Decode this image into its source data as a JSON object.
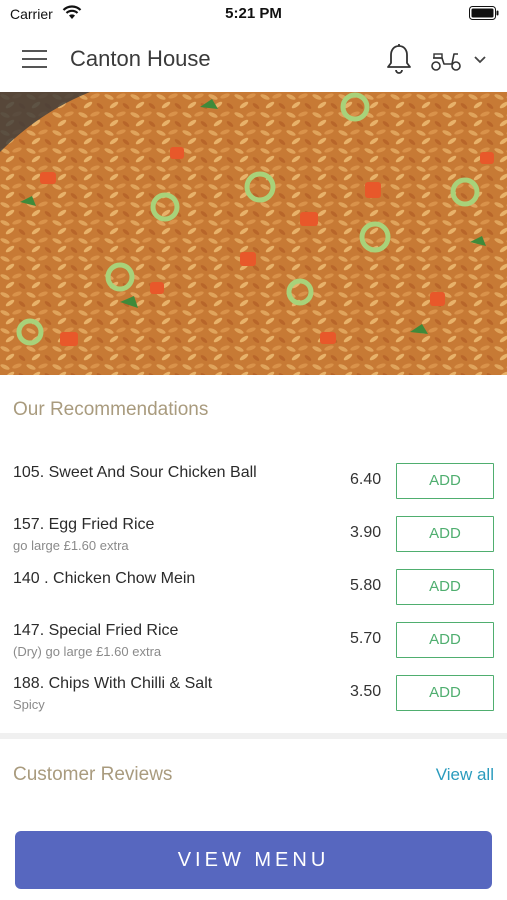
{
  "status_bar": {
    "carrier": "Carrier",
    "time": "5:21 PM"
  },
  "header": {
    "title": "Canton House",
    "icons": [
      "menu-icon",
      "bell-icon",
      "scooter-icon",
      "chevron-down-icon"
    ]
  },
  "recommendations": {
    "title": "Our Recommendations",
    "items": [
      {
        "name": "105. Sweet And Sour Chicken Ball",
        "desc": "",
        "price": "6.40",
        "button": "ADD"
      },
      {
        "name": "157. Egg Fried Rice",
        "desc": "go large £1.60 extra",
        "price": "3.90",
        "button": "ADD"
      },
      {
        "name": "140 . Chicken Chow Mein",
        "desc": "",
        "price": "5.80",
        "button": "ADD"
      },
      {
        "name": "147. Special Fried Rice",
        "desc": "(Dry) go large £1.60 extra",
        "price": "5.70",
        "button": "ADD"
      },
      {
        "name": "188. Chips With Chilli & Salt",
        "desc": "Spicy",
        "price": "3.50",
        "button": "ADD"
      }
    ]
  },
  "reviews": {
    "title": "Customer Reviews",
    "view_all": "View all"
  },
  "footer": {
    "view_menu": "VIEW MENU"
  },
  "colors": {
    "accent_green": "#4fae6f",
    "button_blue": "#5767bf",
    "link_blue": "#2a9bbd",
    "section_title": "#a99b7e"
  }
}
